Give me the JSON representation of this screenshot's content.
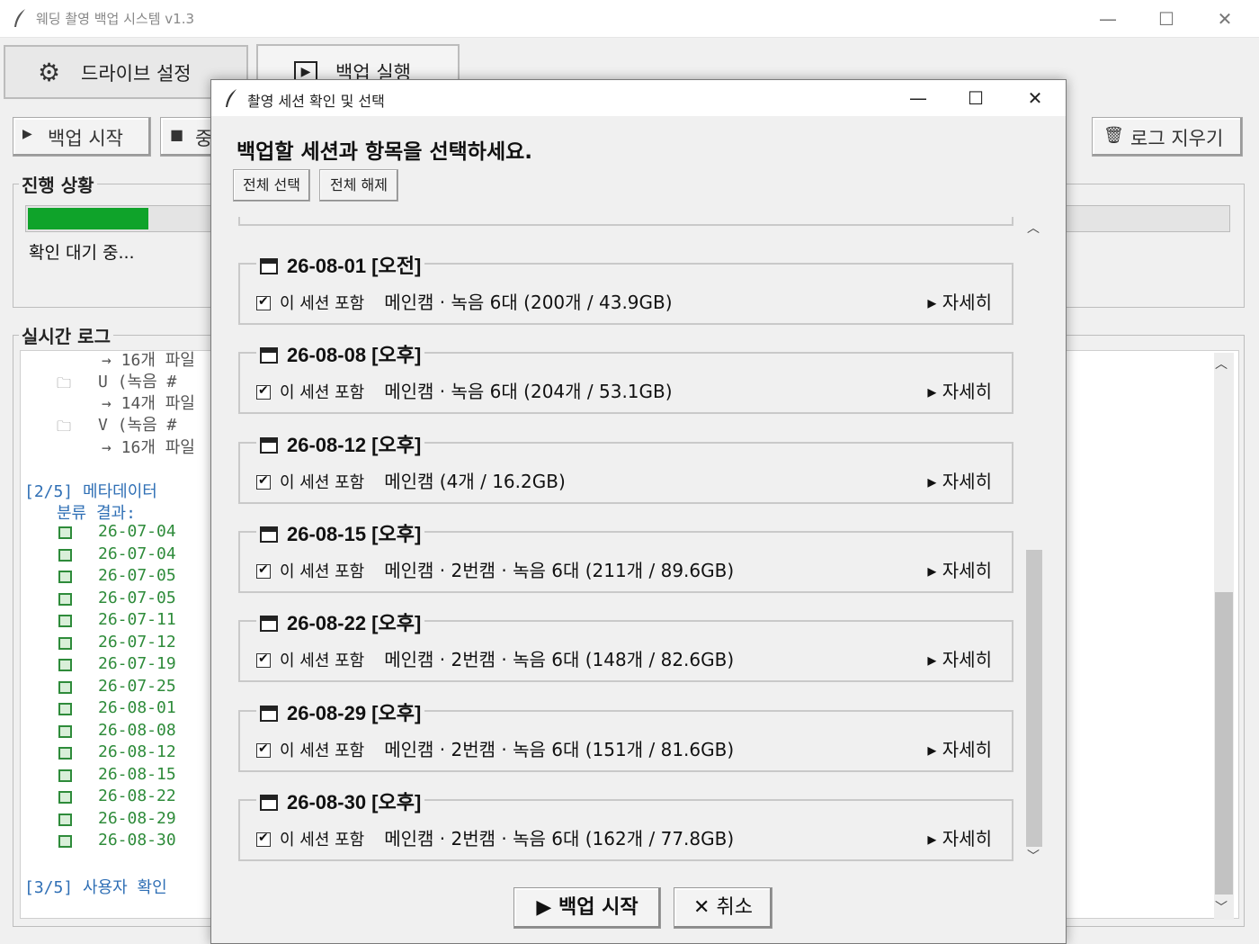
{
  "main_window": {
    "title": "웨딩 촬영 백업 시스템 v1.3",
    "tabs": [
      {
        "label": "드라이브 설정"
      },
      {
        "label": "백업 실행"
      }
    ],
    "toolbar": {
      "start_label": "백업 시작",
      "stop_label": "중",
      "clear_log_label": "로그 지우기"
    },
    "progress": {
      "group_label": "진행 상황",
      "status_text": "확인 대기 중...",
      "fill_fraction": 0.1
    },
    "log": {
      "group_label": "실시간 로그",
      "lines_top": [
        {
          "text": "→ 16개 파일"
        },
        {
          "text": "U  (녹음 #"
        },
        {
          "text": "→ 14개 파일"
        },
        {
          "text": "V  (녹음 #"
        },
        {
          "text": "→ 16개 파일"
        }
      ],
      "step2": "[2/5]  메타데이터",
      "step2_sub": "분류 결과:",
      "dates": [
        "26-07-04",
        "26-07-04",
        "26-07-05",
        "26-07-05",
        "26-07-11",
        "26-07-12",
        "26-07-19",
        "26-07-25",
        "26-08-01",
        "26-08-08",
        "26-08-12",
        "26-08-15",
        "26-08-22",
        "26-08-29",
        "26-08-30"
      ],
      "step3": "[3/5]  사용자 확인"
    }
  },
  "dialog": {
    "title": "촬영 세션 확인 및 선택",
    "heading": "백업할 세션과 항목을 선택하세요.",
    "select_all_label": "전체 선택",
    "deselect_all_label": "전체 해제",
    "include_label": "이 세션 포함",
    "detail_label": "▸ 자세히",
    "sessions": [
      {
        "title": "26-08-01 [오전]",
        "summary": "메인캠 · 녹음 6대  (200개 / 43.9GB)",
        "checked": true
      },
      {
        "title": "26-08-08 [오후]",
        "summary": "메인캠 · 녹음 6대  (204개 / 53.1GB)",
        "checked": true
      },
      {
        "title": "26-08-12 [오후]",
        "summary": "메인캠  (4개 / 16.2GB)",
        "checked": true
      },
      {
        "title": "26-08-15 [오후]",
        "summary": "메인캠 · 2번캠 · 녹음 6대  (211개 / 89.6GB)",
        "checked": true
      },
      {
        "title": "26-08-22 [오후]",
        "summary": "메인캠 · 2번캠 · 녹음 6대  (148개 / 82.6GB)",
        "checked": true
      },
      {
        "title": "26-08-29 [오후]",
        "summary": "메인캠 · 2번캠 · 녹음 6대  (151개 / 81.6GB)",
        "checked": true
      },
      {
        "title": "26-08-30 [오후]",
        "summary": "메인캠 · 2번캠 · 녹음 6대  (162개 / 77.8GB)",
        "checked": true
      }
    ],
    "start_label": "▶ 백업 시작",
    "cancel_label": "✕ 취소"
  },
  "colors": {
    "progress_fill": "#0fa32a",
    "log_green": "#2e8b3a",
    "log_blue": "#2f6fb5"
  },
  "icons": [
    "feather-icon",
    "gear-icon",
    "play-icon",
    "stop-icon",
    "trash-icon",
    "calendar-icon",
    "folder-icon",
    "checkbox-icon"
  ]
}
